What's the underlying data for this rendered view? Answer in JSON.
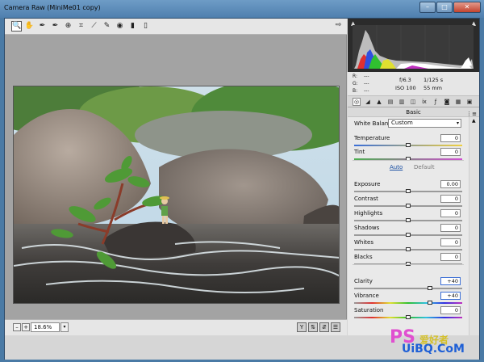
{
  "window": {
    "title": "Camera Raw (MiniMe01 copy)",
    "min": "–",
    "max": "□",
    "close": "✕"
  },
  "toolbar": {
    "tools": [
      {
        "name": "zoom-tool",
        "glyph": "🔍"
      },
      {
        "name": "hand-tool",
        "glyph": "✋"
      },
      {
        "name": "white-balance-tool",
        "glyph": "✒"
      },
      {
        "name": "color-sampler-tool",
        "glyph": "✒"
      },
      {
        "name": "targeted-adjustment-tool",
        "glyph": "⊕"
      },
      {
        "name": "crop-tool",
        "glyph": "⌗"
      },
      {
        "name": "straighten-tool",
        "glyph": "⟋"
      },
      {
        "name": "spot-removal-tool",
        "glyph": "✎"
      },
      {
        "name": "red-eye-tool",
        "glyph": "◉"
      },
      {
        "name": "adjustment-brush-tool",
        "glyph": "▮"
      },
      {
        "name": "graduated-filter-tool",
        "glyph": "▯"
      }
    ],
    "open_preferences": "⇨"
  },
  "histogram": {
    "rgb": {
      "r": "R:",
      "g": "G:",
      "b": "B:",
      "dash": "---"
    },
    "aperture": "f/6.3",
    "shutter": "1/125 s",
    "iso": "ISO 100",
    "focal": "55 mm"
  },
  "panel": {
    "title": "Basic",
    "menu": "⋮≡"
  },
  "white_balance": {
    "label": "White Balance:",
    "value": "Custom"
  },
  "sliders_top": [
    {
      "label": "Temperature",
      "value": "0",
      "pos": 0.5,
      "track": "linear-gradient(90deg,#3b6fd8,#f0d040)"
    },
    {
      "label": "Tint",
      "value": "0",
      "pos": 0.5,
      "track": "linear-gradient(90deg,#4caf50,#d04fd0)"
    }
  ],
  "auto_label": "Auto",
  "default_label": "Default",
  "sliders_mid": [
    {
      "label": "Exposure",
      "value": "0.00",
      "pos": 0.5
    },
    {
      "label": "Contrast",
      "value": "0",
      "pos": 0.5
    },
    {
      "label": "Highlights",
      "value": "0",
      "pos": 0.5
    },
    {
      "label": "Shadows",
      "value": "0",
      "pos": 0.5
    },
    {
      "label": "Whites",
      "value": "0",
      "pos": 0.5
    },
    {
      "label": "Blacks",
      "value": "0",
      "pos": 0.5
    }
  ],
  "sliders_bottom": [
    {
      "label": "Clarity",
      "value": "+40",
      "pos": 0.7
    },
    {
      "label": "Vibrance",
      "value": "+40",
      "pos": 0.7,
      "track": "linear-gradient(90deg,#999,#e03030,#e0e030,#30c030,#30c0e0,#3030e0,#c030c0)"
    },
    {
      "label": "Saturation",
      "value": "0",
      "pos": 0.5,
      "track": "linear-gradient(90deg,#999,#e03030,#e0e030,#30c030,#30c0e0,#3030e0,#c030c0)"
    }
  ],
  "status": {
    "zoom": "18.6%",
    "minus": "–",
    "plus": "+"
  },
  "watermark": {
    "ps": "PS",
    "cn": "爱好者",
    "ub": "UiBQ.CoM"
  }
}
